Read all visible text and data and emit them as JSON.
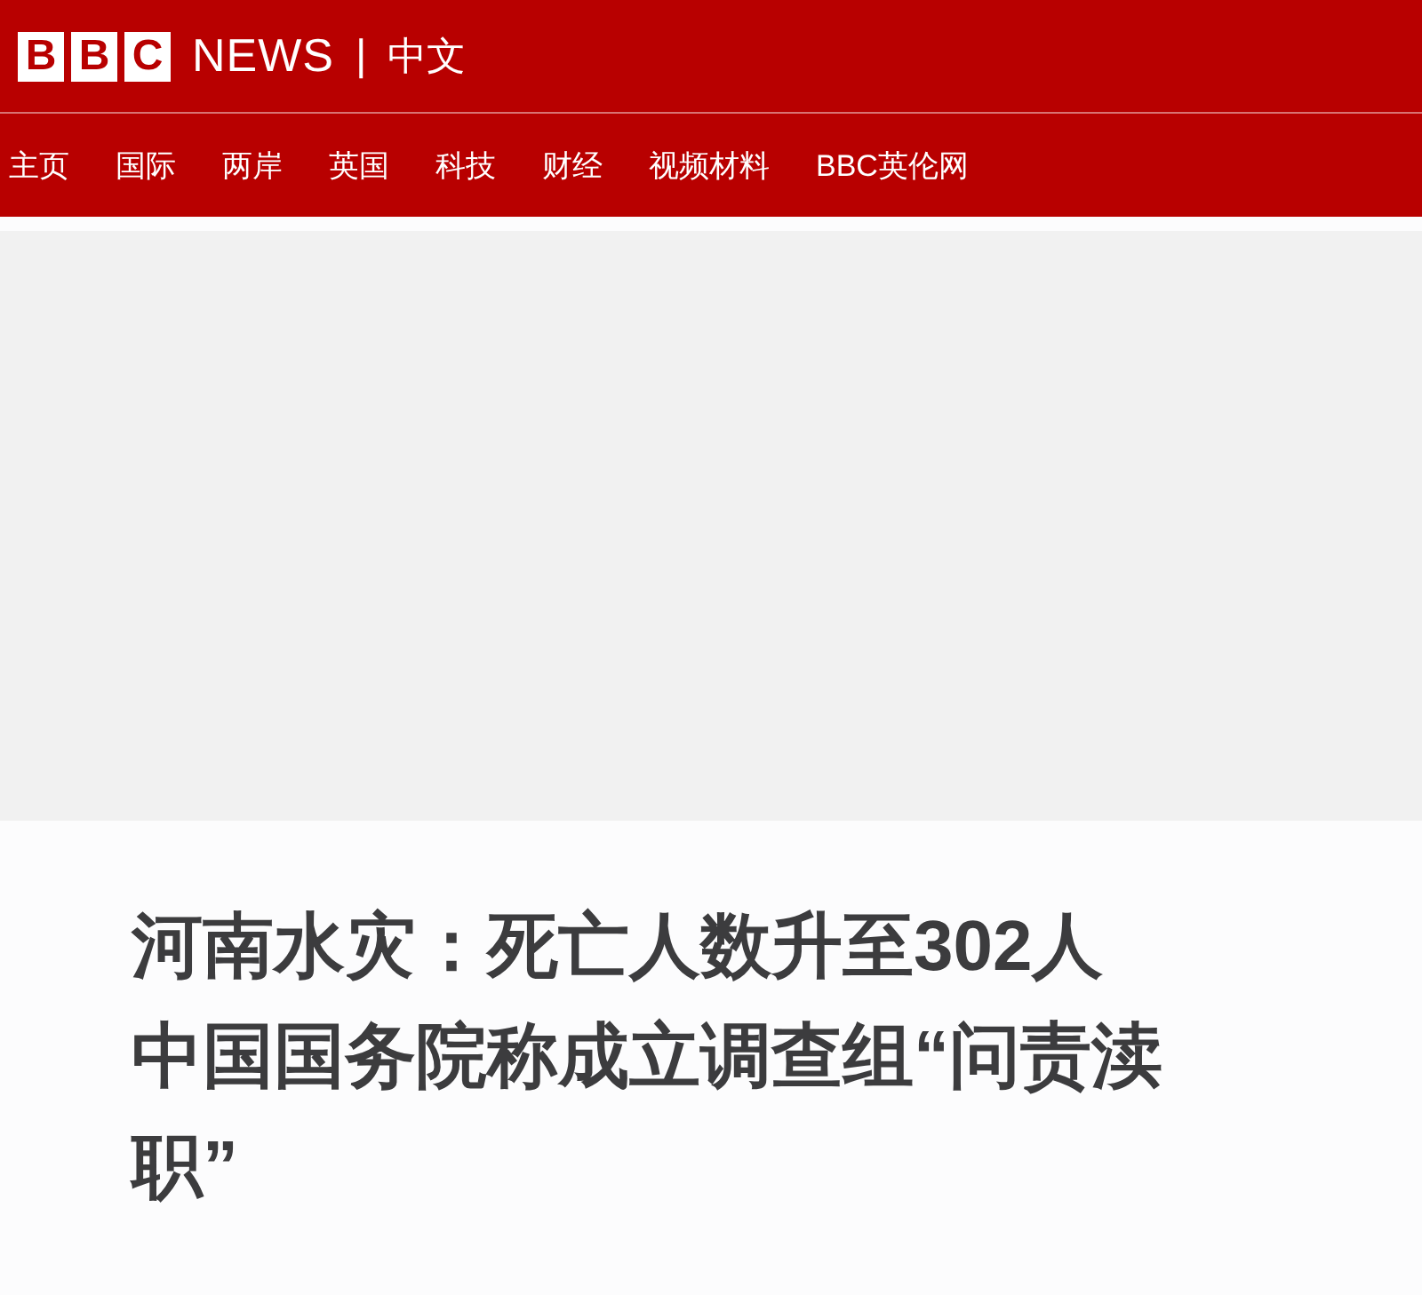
{
  "header": {
    "logo_letters": [
      "B",
      "B",
      "C"
    ],
    "brand": "NEWS",
    "separator": "|",
    "edition": "中文"
  },
  "nav": {
    "items": [
      {
        "label": "主页",
        "selected": false
      },
      {
        "label": "国际",
        "selected": false
      },
      {
        "label": "两岸",
        "selected": false
      },
      {
        "label": "英国",
        "selected": false
      },
      {
        "label": "科技",
        "selected": false
      },
      {
        "label": "财经",
        "selected": false
      },
      {
        "label": "视频材料",
        "selected": false
      },
      {
        "label": "BBC英伦网",
        "selected": false
      }
    ]
  },
  "article": {
    "media": {
      "kind": "placeholder"
    },
    "headline_lines": [
      "河南水灾：死亡人数升至302人",
      "中国国务院称成立调查组“问责渎",
      "职”"
    ]
  }
}
